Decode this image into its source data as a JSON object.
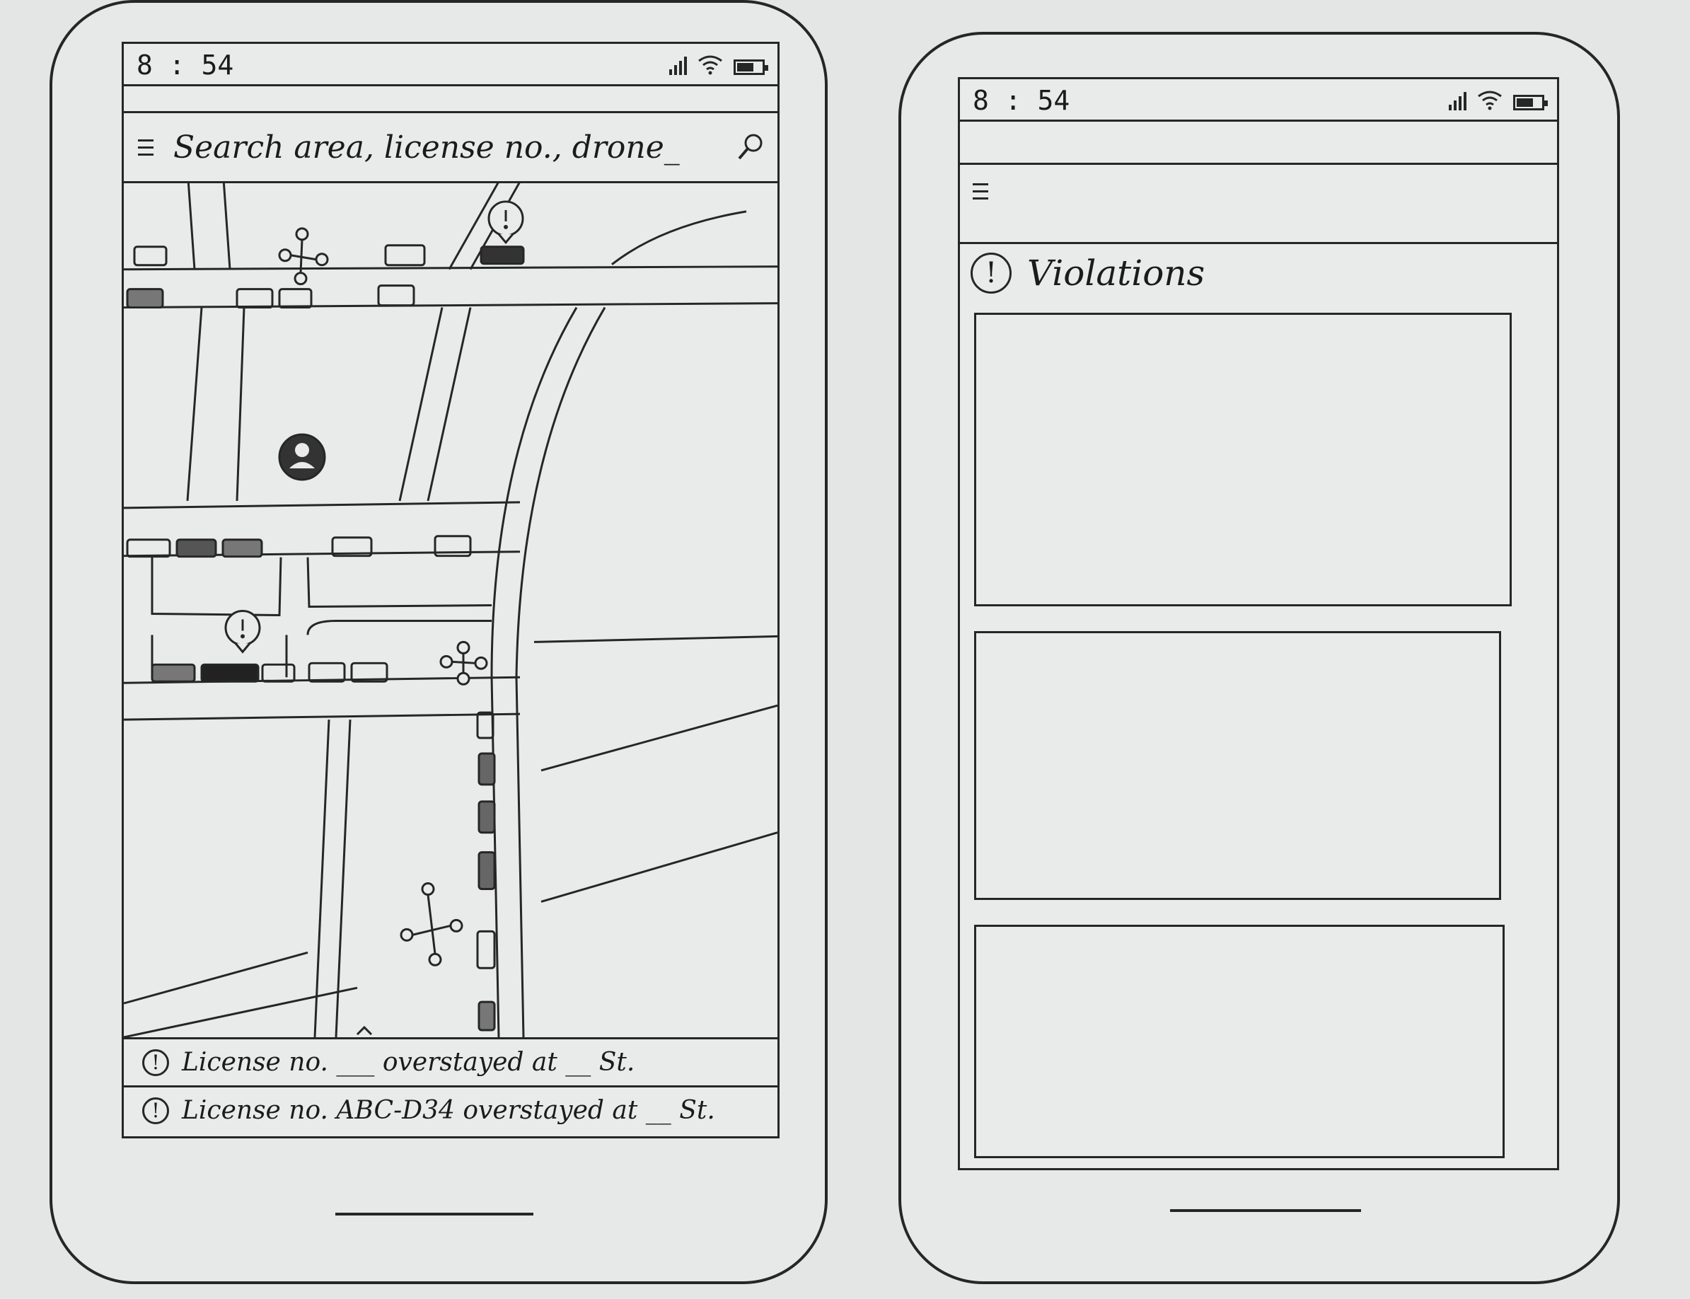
{
  "status_bar": {
    "time": "8 : 54"
  },
  "map_screen": {
    "search": {
      "placeholder": "Search area, license no., drone_"
    },
    "notifications": [
      {
        "text": "License no. ___ overstayed at __ St."
      },
      {
        "text": "License no. ABC-D34 overstayed at __ St."
      }
    ]
  },
  "violations_screen": {
    "title": "Violations",
    "cards": 3
  },
  "icons": {
    "menu": "hamburger-icon",
    "search": "search-icon",
    "alert": "alert-icon",
    "drone": "drone-icon",
    "user_location": "user-location-icon",
    "signal": "signal-icon",
    "wifi": "wifi-icon",
    "battery": "battery-icon"
  },
  "alert_glyph": "!"
}
